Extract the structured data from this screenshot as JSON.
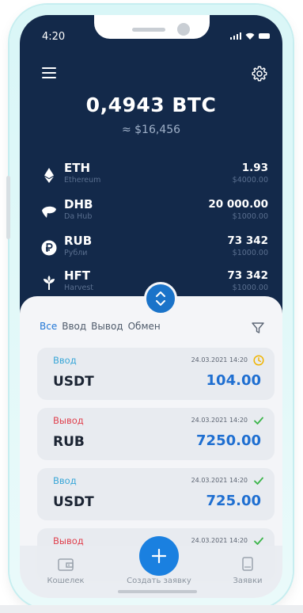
{
  "status_bar": {
    "time": "4:20"
  },
  "balance": {
    "main": "0,4943 BTC",
    "fiat": "≈ $16,456"
  },
  "assets": [
    {
      "symbol": "ETH",
      "name": "Ethereum",
      "amount": "1.93",
      "usd": "$4000.00",
      "icon": "ethereum-icon"
    },
    {
      "symbol": "DHB",
      "name": "Da Hub",
      "amount": "20 000.00",
      "usd": "$1000.00",
      "icon": "dhb-icon"
    },
    {
      "symbol": "RUB",
      "name": "Рубли",
      "amount": "73 342",
      "usd": "$1000.00",
      "icon": "ruble-icon"
    },
    {
      "symbol": "HFT",
      "name": "Harvest",
      "amount": "73 342",
      "usd": "$1000.00",
      "icon": "harvest-icon"
    }
  ],
  "filters": [
    "Все",
    "Ввод",
    "Вывод",
    "Обмен"
  ],
  "active_filter": "Все",
  "transactions": [
    {
      "type": "Ввод",
      "direction": "in",
      "date": "24.03.2021 14:20",
      "status": "pending",
      "currency": "USDT",
      "amount": "104.00"
    },
    {
      "type": "Вывод",
      "direction": "out",
      "date": "24.03.2021 14:20",
      "status": "done",
      "currency": "RUB",
      "amount": "7250.00"
    },
    {
      "type": "Ввод",
      "direction": "in",
      "date": "24.03.2021 14:20",
      "status": "done",
      "currency": "USDT",
      "amount": "725.00"
    },
    {
      "type": "Вывод",
      "direction": "out",
      "date": "24.03.2021 14:20",
      "status": "done",
      "currency": "",
      "amount": ""
    }
  ],
  "tabbar": {
    "wallet": "Кошелек",
    "create": "Создать заявку",
    "requests": "Заявки"
  },
  "colors": {
    "header_bg": "#13294a",
    "accent": "#1a80e0",
    "in": "#3aa7d8",
    "out": "#e0424f",
    "success": "#3bb54a",
    "pending": "#f0b400"
  }
}
